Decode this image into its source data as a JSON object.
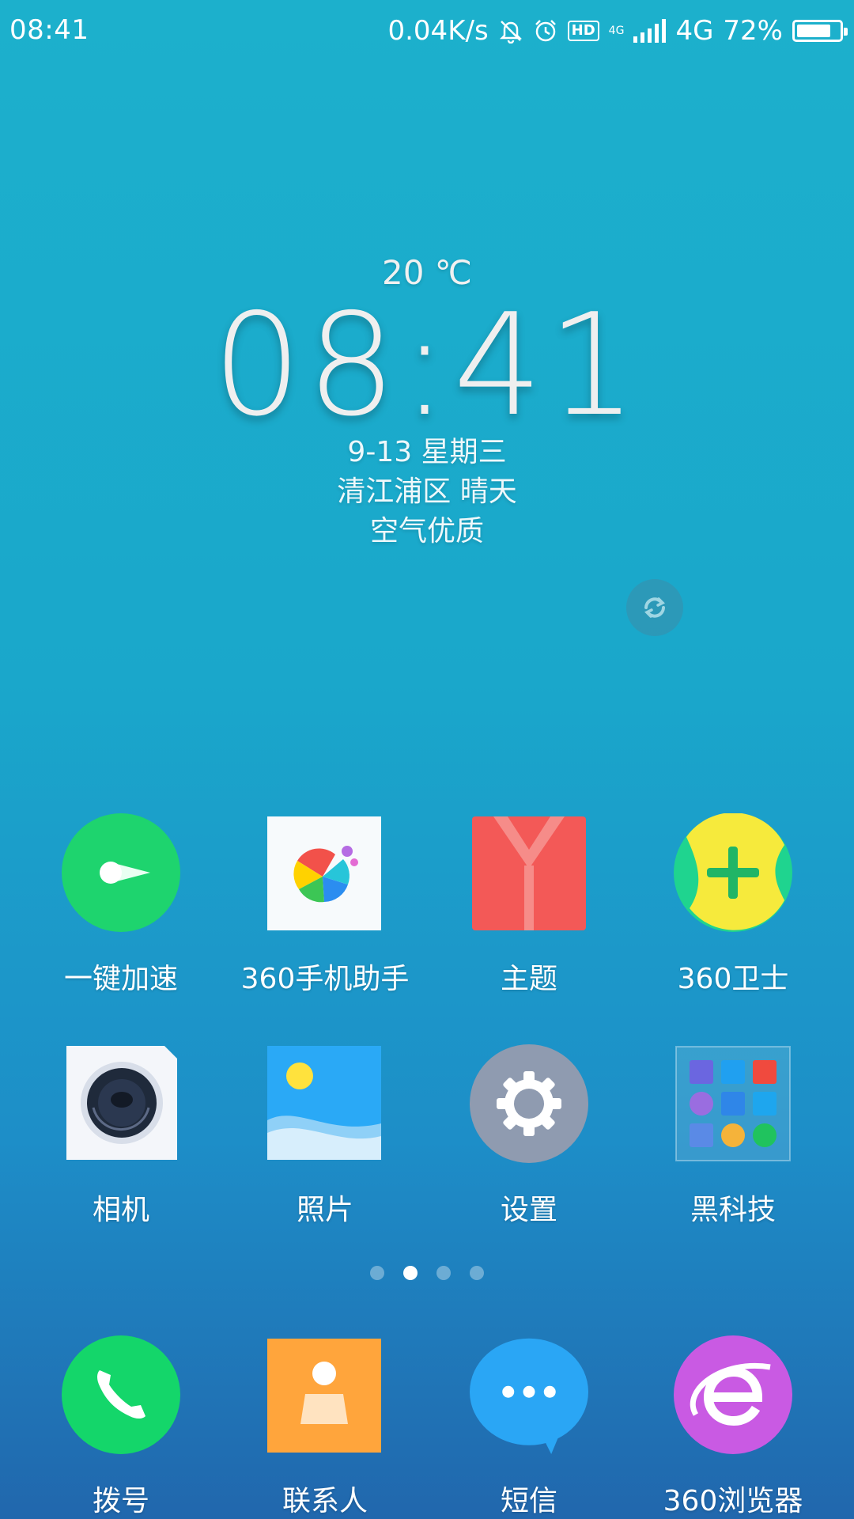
{
  "status_bar": {
    "time": "08:41",
    "net_speed": "0.04K/s",
    "hd_label": "HD",
    "net_small": "4G",
    "net_type": "4G",
    "battery_percent": "72%",
    "battery_level": 0.72
  },
  "widget": {
    "temperature": "20 ℃",
    "clock": "08:41",
    "date": "9-13 星期三",
    "location_weather": "清江浦区 晴天",
    "air_quality": "空气优质"
  },
  "apps_row1": [
    {
      "label": "一键加速",
      "icon": "rocket-speed-icon"
    },
    {
      "label": "360手机助手",
      "icon": "app-store-icon"
    },
    {
      "label": "主题",
      "icon": "theme-shirt-icon"
    },
    {
      "label": "360卫士",
      "icon": "security-plus-icon"
    }
  ],
  "apps_row2": [
    {
      "label": "相机",
      "icon": "camera-icon"
    },
    {
      "label": "照片",
      "icon": "photos-icon"
    },
    {
      "label": "设置",
      "icon": "gear-icon"
    },
    {
      "label": "黑科技",
      "icon": "folder-icon"
    }
  ],
  "dock": [
    {
      "label": "拨号",
      "icon": "phone-icon"
    },
    {
      "label": "联系人",
      "icon": "contacts-icon"
    },
    {
      "label": "短信",
      "icon": "messages-icon"
    },
    {
      "label": "360浏览器",
      "icon": "browser-icon"
    }
  ],
  "pager": {
    "pages": 4,
    "active": 1
  },
  "colors": {
    "green_accel": "#1ed46e",
    "theme_red": "#f35957",
    "settings_gray": "#8f9bb0",
    "phone_green": "#14d66a",
    "contacts_orange": "#ffa53c",
    "messages_blue": "#2aa6f5",
    "browser_purple": "#c95ae3"
  }
}
